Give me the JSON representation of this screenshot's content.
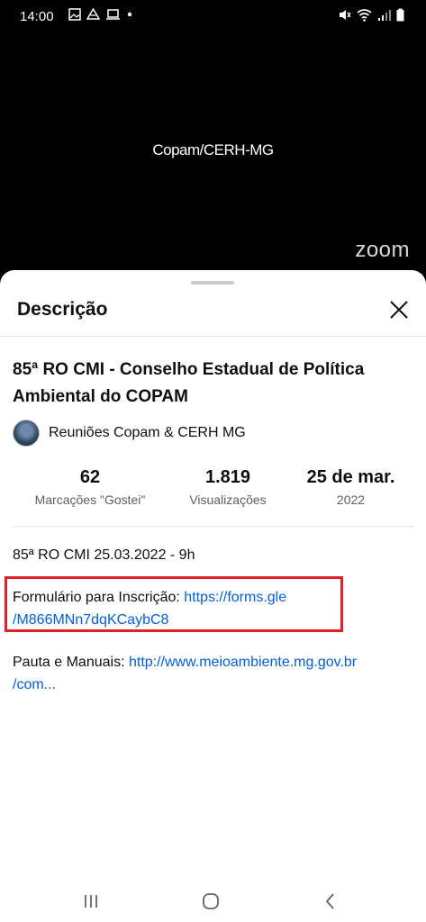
{
  "status_bar": {
    "time": "14:00"
  },
  "video": {
    "title": "Copam/CERH-MG",
    "logo_text": "zoom"
  },
  "sheet": {
    "title": "Descrição",
    "video_title": "85ª RO CMI - Conselho Estadual de Política Ambiental do COPAM",
    "channel": "Reuniões Copam & CERH MG",
    "stats": {
      "likes_value": "62",
      "likes_label": "Marcações \"Gostei\"",
      "views_value": "1.819",
      "views_label": "Visualizações",
      "date_value": "25 de mar.",
      "date_label": "2022"
    },
    "description": {
      "line1": "85ª RO CMI 25.03.2022 - 9h",
      "form_prefix": "Formulário para Inscrição: ",
      "form_link_part1": "https://forms.gle",
      "form_link_part2": "/M866MNn7dqKCaybC8",
      "pauta_prefix": "Pauta e Manuais: ",
      "pauta_link_part1": "http://www.meioambiente.mg.gov.br",
      "pauta_link_part2": "/com..."
    }
  },
  "colors": {
    "link": "#065fd4",
    "highlight": "#e0202a"
  }
}
